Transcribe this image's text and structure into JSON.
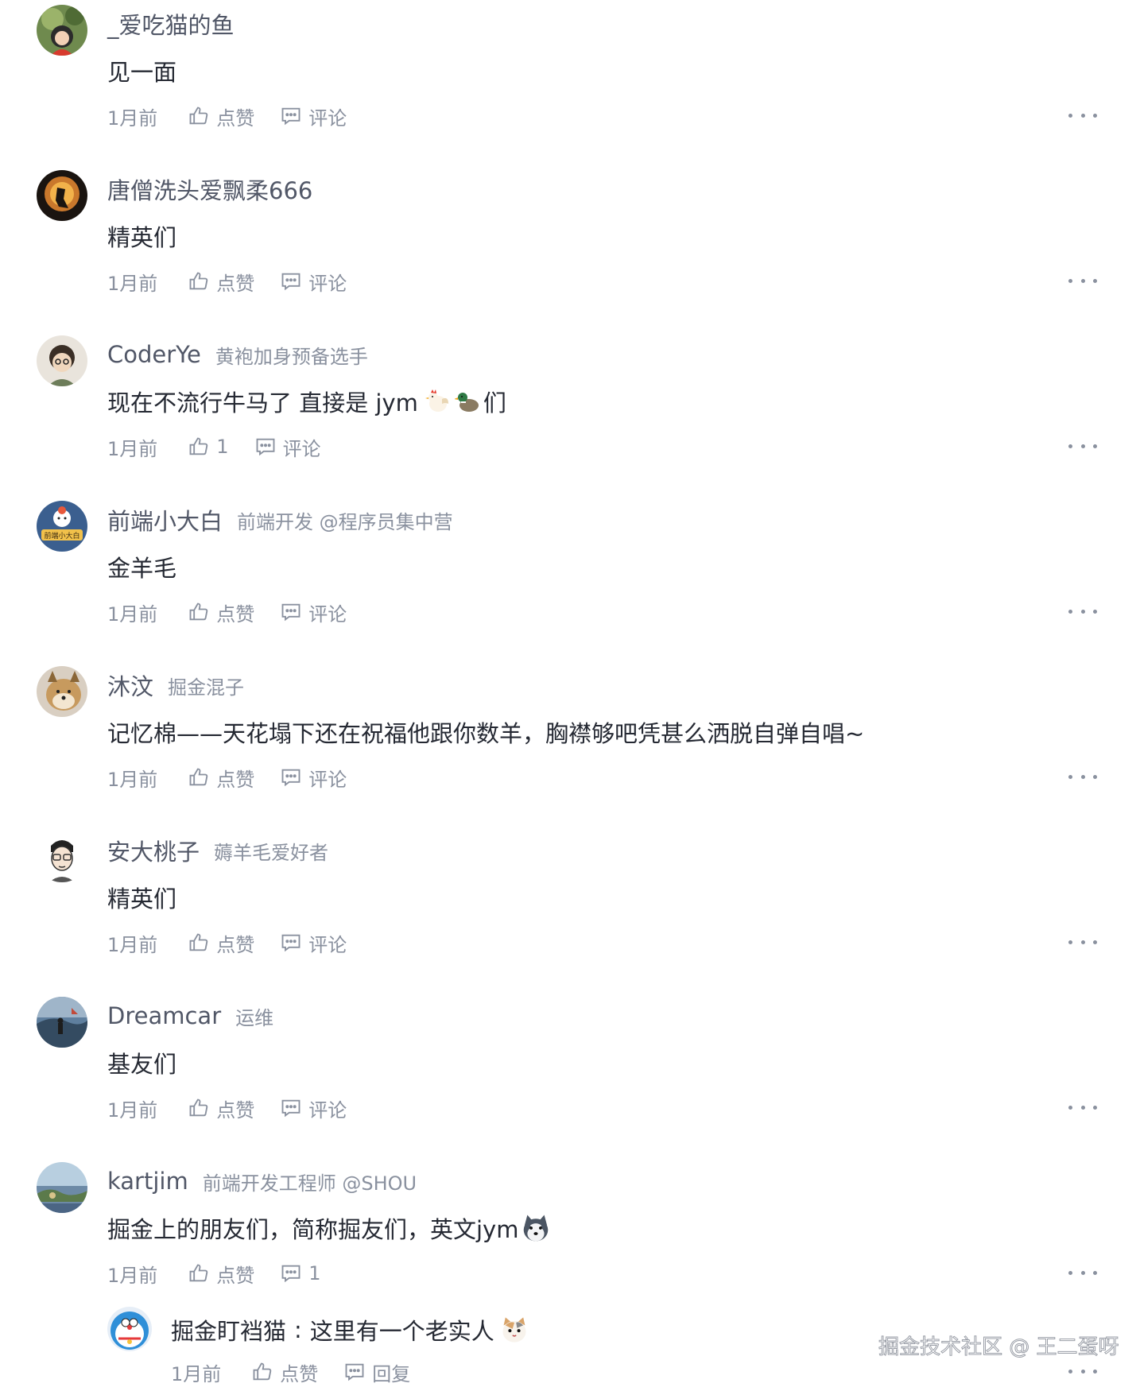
{
  "comments": [
    {
      "username": "_爱吃猫的鱼",
      "title": "",
      "content": "见一面",
      "time": "1月前",
      "like": "点赞",
      "comment": "评论"
    },
    {
      "username": "唐僧洗头爱飘柔666",
      "title": "",
      "content": "精英们",
      "time": "1月前",
      "like": "点赞",
      "comment": "评论"
    },
    {
      "username": "CoderYe",
      "title": "黄袍加身预备选手",
      "content": "现在不流行牛马了 直接是 jym",
      "content_suffix": "们",
      "time": "1月前",
      "like": "1",
      "comment": "评论"
    },
    {
      "username": "前端小大白",
      "title": "前端开发 @程序员集中营",
      "content": "金羊毛",
      "time": "1月前",
      "like": "点赞",
      "comment": "评论",
      "avatar_text": "前端小大白"
    },
    {
      "username": "沐汶",
      "title": "掘金混子",
      "content": "记忆棉——天花塌下还在祝福他跟你数羊，胸襟够吧凭甚么洒脱自弹自唱~",
      "time": "1月前",
      "like": "点赞",
      "comment": "评论"
    },
    {
      "username": "安大桃子",
      "title": "薅羊毛爱好者",
      "content": "精英们",
      "time": "1月前",
      "like": "点赞",
      "comment": "评论"
    },
    {
      "username": "Dreamcar",
      "title": "运维",
      "content": "基友们",
      "time": "1月前",
      "like": "点赞",
      "comment": "评论"
    },
    {
      "username": "kartjim",
      "title": "前端开发工程师 @SHOU",
      "content": "掘金上的朋友们，简称掘友们，英文jym",
      "time": "1月前",
      "like": "点赞",
      "comment": "1"
    }
  ],
  "reply": {
    "username": "掘金盯裆猫",
    "colon": ":",
    "content": "这里有一个老实人",
    "time": "1月前",
    "like": "点赞",
    "reply": "回复"
  },
  "watermark": "掘金技术社区 @ 王二蛋呀",
  "colors": {
    "username": "#515767",
    "title": "#8a919f",
    "content": "#252933",
    "meta": "#8a919f"
  },
  "icons": [
    "like-icon",
    "comment-icon",
    "more-icon",
    "emoji-chicken-icon",
    "emoji-duck-icon",
    "emoji-husky-icon",
    "emoji-cat-icon"
  ]
}
